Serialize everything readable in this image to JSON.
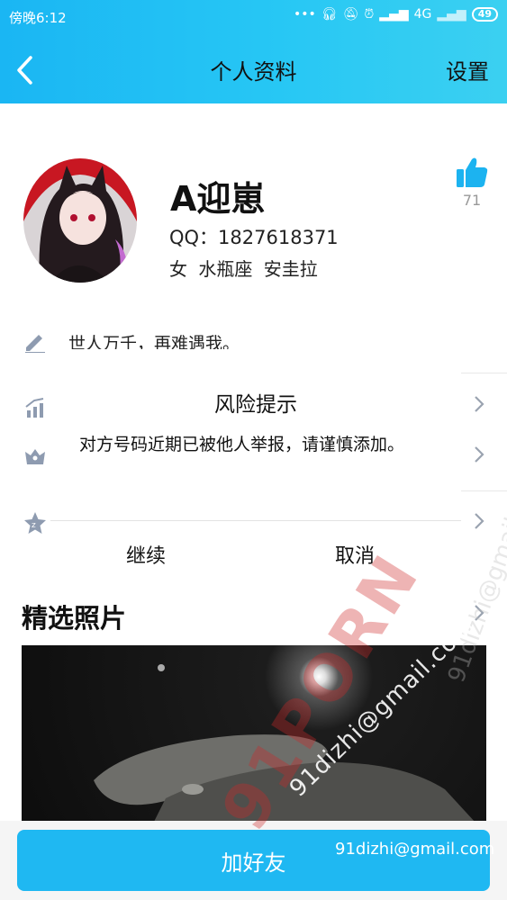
{
  "status_bar": {
    "time": "傍晚6:12",
    "network": "4G",
    "battery": "49"
  },
  "header": {
    "title": "个人资料",
    "settings_label": "设置"
  },
  "profile": {
    "name": "A迎崽",
    "qq": "QQ：1827618371",
    "info": "女 水瓶座 安圭拉",
    "like_count": "71",
    "signature": "世人万千，再难遇我。"
  },
  "section": {
    "photos_title": "精选照片"
  },
  "dialog": {
    "title": "风险提示",
    "message": "对方号码近期已被他人举报，请谨慎添加。",
    "continue_label": "继续",
    "cancel_label": "取消"
  },
  "bottom": {
    "add_friend_label": "加好友"
  },
  "watermark": {
    "brand": "91PORN",
    "email": "91dizhi@gmail.com"
  },
  "colors": {
    "accent": "#1fb8f2",
    "watermark_red": "#cd2828"
  }
}
